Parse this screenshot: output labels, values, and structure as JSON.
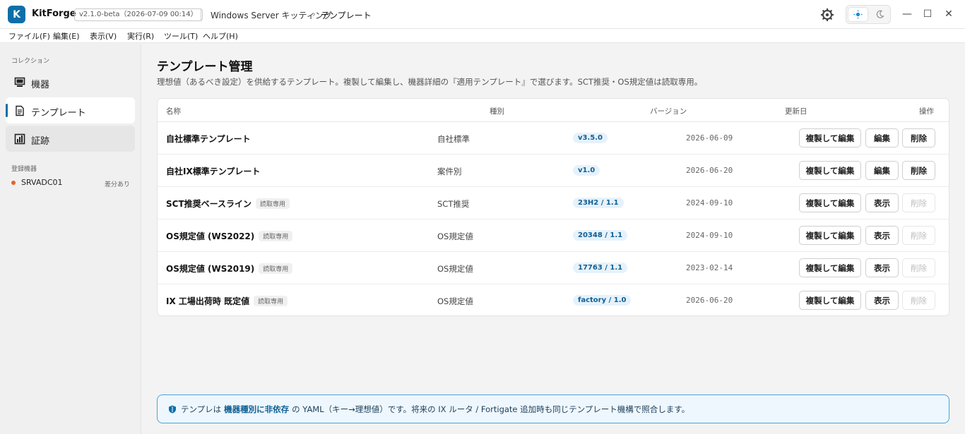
{
  "app": {
    "logo_letter": "K",
    "name": "KitForge",
    "version": "v2.1.0-beta（2026-07-09 00:14）",
    "breadcrumb": [
      "Windows Server キッティング",
      "テンプレート"
    ],
    "breadcrumb_sep": "›"
  },
  "window_controls": {
    "minimize": "—",
    "maximize": "☐",
    "close": "✕"
  },
  "menu": [
    "ファイル(F)",
    "編集(E)",
    "表示(V)",
    "実行(R)",
    "ツール(T)",
    "ヘルプ(H)"
  ],
  "sidebar": {
    "section_collection": "コレクション",
    "items": [
      {
        "label": "機器",
        "icon": "server-icon"
      },
      {
        "label": "テンプレート",
        "icon": "document-icon"
      },
      {
        "label": "証跡",
        "icon": "chart-icon"
      }
    ],
    "section_devices": "登録機器",
    "device": {
      "name": "SRVADC01",
      "status": "差分あり",
      "status_color": "#e8602c"
    }
  },
  "main": {
    "title": "テンプレート管理",
    "description": "理想値（あるべき設定）を供給するテンプレート。複製して編集し、機器詳細の『適用テンプレート』で選びます。SCT推奨・OS規定値は読取専用。",
    "columns": [
      "名称",
      "種別",
      "バージョン",
      "更新日",
      "操作"
    ],
    "rows": [
      {
        "name": "自社標準テンプレート",
        "readonly": "",
        "kind": "自社標準",
        "version": "v3.5.0",
        "date": "2026-06-09",
        "copy": "複製して編集",
        "edit": "編集",
        "del": "削除",
        "editable": true
      },
      {
        "name": "自社IX標準テンプレート",
        "readonly": "",
        "kind": "案件別",
        "version": "v1.0",
        "date": "2026-06-20",
        "copy": "複製して編集",
        "edit": "編集",
        "del": "削除",
        "editable": true
      },
      {
        "name": "SCT推奨ベースライン",
        "readonly": "読取専用",
        "kind": "SCT推奨",
        "version": "23H2 / 1.1",
        "date": "2024-09-10",
        "copy": "複製して編集",
        "edit": "表示",
        "del": "削除",
        "editable": false
      },
      {
        "name": "OS規定値 (WS2022)",
        "readonly": "読取専用",
        "kind": "OS規定値",
        "version": "20348 / 1.1",
        "date": "2024-09-10",
        "copy": "複製して編集",
        "edit": "表示",
        "del": "削除",
        "editable": false
      },
      {
        "name": "OS規定値 (WS2019)",
        "readonly": "読取専用",
        "kind": "OS規定値",
        "version": "17763 / 1.1",
        "date": "2023-02-14",
        "copy": "複製して編集",
        "edit": "表示",
        "del": "削除",
        "editable": false
      },
      {
        "name": "IX 工場出荷時 既定値",
        "readonly": "読取専用",
        "kind": "OS規定値",
        "version": "factory / 1.0",
        "date": "2026-06-20",
        "copy": "複製して編集",
        "edit": "表示",
        "del": "削除",
        "editable": false
      }
    ]
  },
  "info": {
    "prefix": "テンプレは",
    "strong": "機器種別に非依存",
    "suffix": "の YAML（キー→理想値）です。将来の IX ルータ / Fortigate 追加時も同じテンプレート機構で照合します。"
  },
  "colors": {
    "accent": "#0e6fa8",
    "info_border": "#4aa3d8"
  }
}
